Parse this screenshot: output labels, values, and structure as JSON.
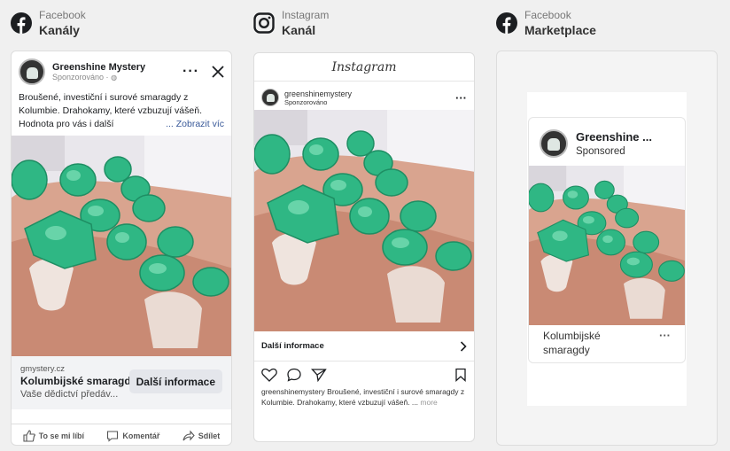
{
  "colors": {
    "fb_blue": "#385898",
    "text": "#1c1e21",
    "muted": "#888888",
    "emerald": "#2fb784"
  },
  "columns": [
    {
      "platform": "Facebook",
      "placement": "Kanály",
      "icon": "facebook-icon"
    },
    {
      "platform": "Instagram",
      "placement": "Kanál",
      "icon": "instagram-icon"
    },
    {
      "platform": "Facebook",
      "placement": "Marketplace",
      "icon": "facebook-icon"
    }
  ],
  "fb_feed": {
    "page_name": "Greenshine Mystery",
    "sponsored": "Sponzorováno ·",
    "body": "Broušené, investiční i surové smaragdy z Kolumbie. Drahokamy, které vzbuzují vášeň. Hodnota pro vás i další",
    "see_more": "... Zobrazit víc",
    "domain": "gmystery.cz",
    "headline": "Kolumbijské smaragdy",
    "description": "Vaše dědictví předáv...",
    "cta": "Další informace",
    "actions": {
      "like": "To se mi líbí",
      "comment": "Komentář",
      "share": "Sdílet"
    }
  },
  "ig_feed": {
    "app_title": "Instagram",
    "username": "greenshinemystery",
    "sponsored": "Sponzorováno",
    "cta": "Další informace",
    "caption_user": "greenshinemystery",
    "caption": " Broušené, investiční i surové smaragdy z Kolumbie. Drahokamy, které vzbuzují vášeň. ...",
    "more": "more"
  },
  "marketplace": {
    "page_name": "Greenshine ...",
    "sponsored": "Sponsored",
    "title": "Kolumbijské smaragdy"
  }
}
